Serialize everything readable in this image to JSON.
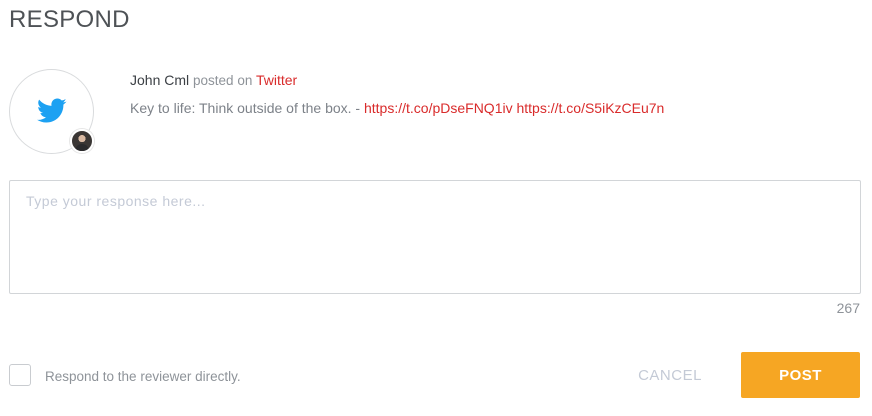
{
  "header": {
    "title": "RESPOND"
  },
  "post": {
    "platform_icon": "twitter-bird-icon",
    "author": "John Cml",
    "posted_on_text": "posted on",
    "platform": "Twitter",
    "text_prefix": "Key to life: Think outside of the box. - ",
    "links": [
      "https://t.co/pDseFNQ1iv",
      "https://t.co/S5iKzCEu7n"
    ]
  },
  "response": {
    "value": "",
    "placeholder": "Type your response here...",
    "remaining_chars": "267"
  },
  "options": {
    "respond_directly_label": "Respond to the reviewer directly.",
    "respond_directly_checked": false
  },
  "actions": {
    "cancel_label": "CANCEL",
    "post_label": "POST"
  },
  "colors": {
    "accent": "#f6a623",
    "link": "#d92b2b",
    "twitter": "#1da1f2"
  }
}
